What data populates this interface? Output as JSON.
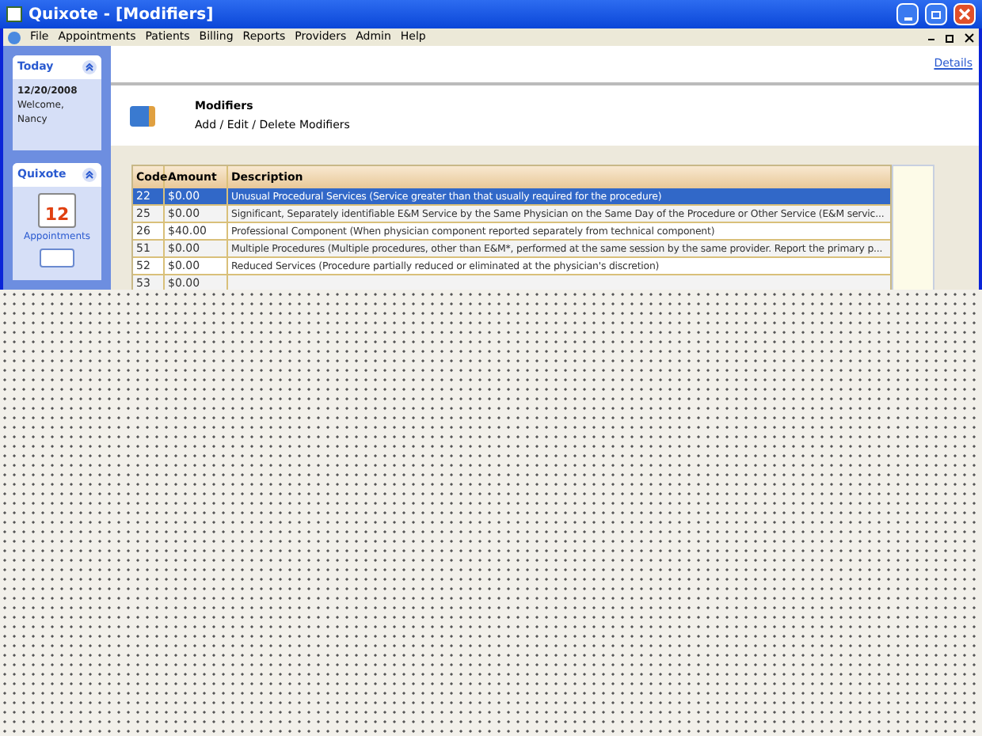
{
  "window": {
    "title": "Quixote - [Modifiers]"
  },
  "menu": [
    "File",
    "Appointments",
    "Patients",
    "Billing",
    "Reports",
    "Providers",
    "Admin",
    "Help"
  ],
  "sidebar": {
    "today": {
      "title": "Today",
      "date": "12/20/2008",
      "welcome": "Welcome,",
      "user": "Nancy"
    },
    "quixote": {
      "title": "Quixote",
      "calendar_day": "12",
      "items": [
        "Appointments"
      ]
    }
  },
  "header": {
    "link": "Details",
    "title": "Modifiers",
    "subtitle": "Add / Edit / Delete Modifiers"
  },
  "table": {
    "columns": [
      "Code",
      "Amount",
      "Description"
    ],
    "rows": [
      {
        "code": "22",
        "amount": "$0.00",
        "description": "Unusual Procedural Services  (Service greater than that usually required for the procedure)",
        "selected": true
      },
      {
        "code": "25",
        "amount": "$0.00",
        "description": "Significant, Separately identifiable E&M Service by the Same Physician on the Same Day of the Procedure or Other Service   (E&M servic...",
        "selected": false
      },
      {
        "code": "26",
        "amount": "$40.00",
        "description": "Professional Component (When physician component reported separately from technical component)",
        "selected": false
      },
      {
        "code": "51",
        "amount": "$0.00",
        "description": "Multiple Procedures (Multiple procedures, other than E&M*, performed at the same session by the same provider.  Report the primary p...",
        "selected": false
      },
      {
        "code": "52",
        "amount": "$0.00",
        "description": "Reduced Services (Procedure partially reduced or eliminated at the physician's discretion)",
        "selected": false
      },
      {
        "code": "53",
        "amount": "$0.00",
        "selected": false
      }
    ]
  }
}
